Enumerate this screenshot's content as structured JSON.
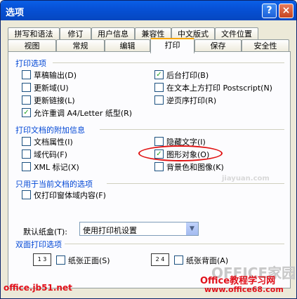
{
  "window": {
    "title": "选项",
    "help_label": "?",
    "close_label": "×"
  },
  "tabs": {
    "row1": [
      "拼写和语法",
      "修订",
      "用户信息",
      "兼容性",
      "中文版式",
      "文件位置"
    ],
    "row2": [
      "视图",
      "常规",
      "编辑",
      "打印",
      "保存",
      "安全性"
    ],
    "active": "打印"
  },
  "print_options": {
    "header": "打印选项",
    "items": [
      {
        "label": "草稿输出(D)",
        "checked": false
      },
      {
        "label": "更新域(U)",
        "checked": false
      },
      {
        "label": "更新链接(L)",
        "checked": false
      },
      {
        "label": "允许重调 A4/Letter 纸型(R)",
        "checked": true
      },
      {
        "label": "后台打印(B)",
        "checked": true
      },
      {
        "label": "在文本上方打印 Postscript(N)",
        "checked": false
      },
      {
        "label": "逆页序打印(R)",
        "checked": false
      }
    ]
  },
  "include_with_document": {
    "header": "打印文档的附加信息",
    "items": [
      {
        "label": "文档属性(I)",
        "checked": false
      },
      {
        "label": "域代码(F)",
        "checked": false
      },
      {
        "label": "XML 标记(X)",
        "checked": false
      },
      {
        "label": "隐藏文字(I)",
        "checked": false
      },
      {
        "label": "图形对象(O)",
        "checked": true
      },
      {
        "label": "背景色和图像(K)",
        "checked": false
      }
    ]
  },
  "current_document": {
    "header": "只用于当前文档的选项",
    "items": [
      {
        "label": "仅打印窗体域内容(F)",
        "checked": false
      }
    ]
  },
  "tray": {
    "label": "默认纸盒(T):",
    "value": "使用打印机设置",
    "arrow": "▼"
  },
  "duplex": {
    "header": "双面打印选项",
    "front_icon": "1 3",
    "back_icon": "2 4",
    "front_label": "纸张正面(S)",
    "back_label": "纸张背面(A)"
  },
  "watermarks": {
    "left": "office.jb51.net",
    "right_top": "Office教程学习网",
    "right_bottom": "www.office68.com",
    "faint1": "jiayuan.com",
    "faint2": "OFFICE家园"
  },
  "colors": {
    "title_bar": "#0751d6",
    "section_header": "#0046d5",
    "highlight": "#e01010",
    "watermark": "#e0101a"
  }
}
